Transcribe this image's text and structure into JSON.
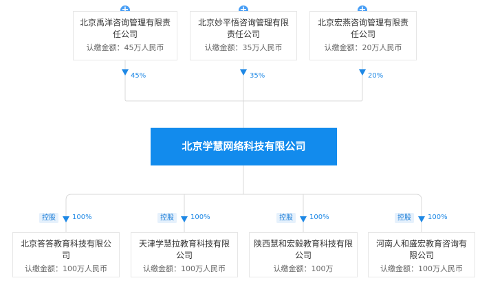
{
  "shareholders": [
    {
      "name": "北京禹洋咨询管理有限责任公司",
      "capital": "认缴金额：45万人民币",
      "percent": "45%"
    },
    {
      "name": "北京妙平悟咨询管理有限责任公司",
      "capital": "认缴金额：35万人民币",
      "percent": "35%"
    },
    {
      "name": "北京宏燕咨询管理有限责任公司",
      "capital": "认缴金额：20万人民币",
      "percent": "20%"
    }
  ],
  "company": {
    "name": "北京学慧网络科技有限公司"
  },
  "subsidiaries": [
    {
      "tag": "控股",
      "percent": "100%",
      "name": "北京答答教育科技有限公司",
      "capital": "认缴金额：100万人民币"
    },
    {
      "tag": "控股",
      "percent": "100%",
      "name": "天津学慧拉教育科技有限公司",
      "capital": "认缴金额：100万人民币"
    },
    {
      "tag": "控股",
      "percent": "100%",
      "name": "陕西慧和宏毅教育科技有限公司",
      "capital": "认缴金额：100万"
    },
    {
      "tag": "控股",
      "percent": "100%",
      "name": "河南人和盛宏教育咨询有限公司",
      "capital": "认缴金额：100万人民币"
    }
  ],
  "icons": {
    "expand": "plus-circle-icon",
    "arrow": "arrow-down-icon"
  },
  "colors": {
    "accent": "#128bed",
    "line": "#d9d9d9",
    "link": "#1e88e5"
  }
}
